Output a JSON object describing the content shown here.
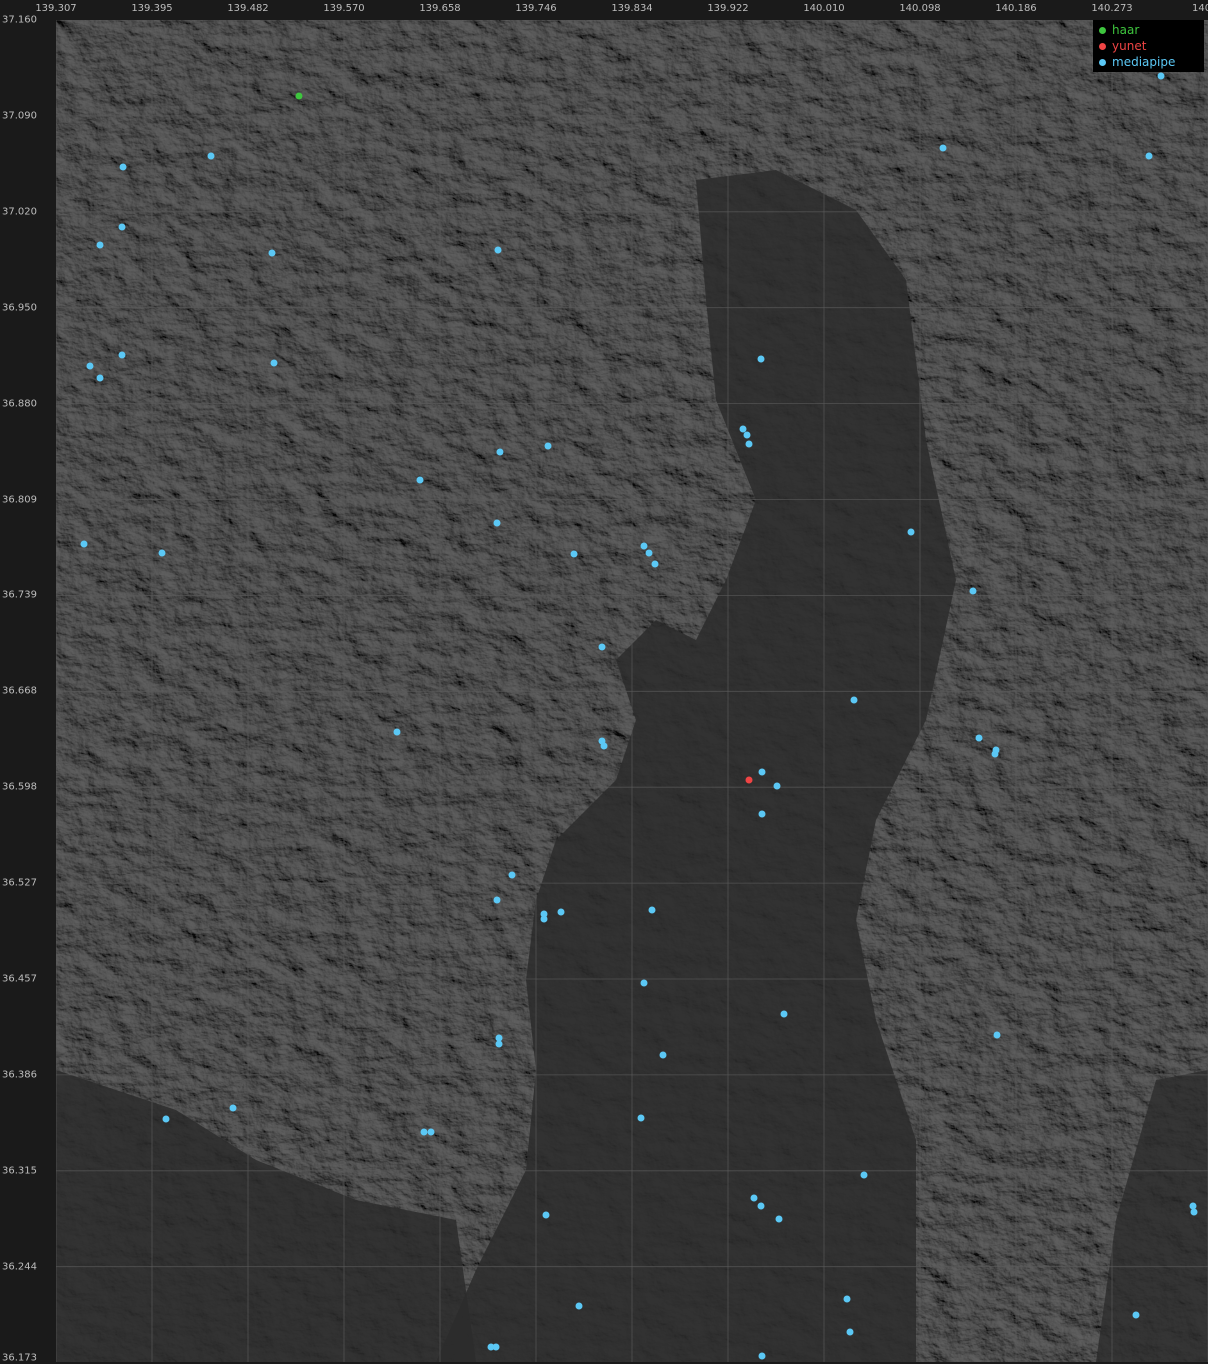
{
  "map": {
    "lon_ticks": [
      "139.307",
      "139.395",
      "139.482",
      "139.570",
      "139.658",
      "139.746",
      "139.834",
      "139.922",
      "140.010",
      "140.098",
      "140.186",
      "140.273",
      "140"
    ],
    "lat_ticks": [
      "37.160",
      "37.090",
      "37.020",
      "36.950",
      "36.880",
      "36.809",
      "36.739",
      "36.668",
      "36.598",
      "36.527",
      "36.457",
      "36.386",
      "36.315",
      "36.244",
      "36.173"
    ],
    "legend": [
      {
        "label": "haar",
        "color": "#3ec53e"
      },
      {
        "label": "yunet",
        "color": "#ef4444"
      },
      {
        "label": "mediapipe",
        "color": "#5bc8f5"
      }
    ],
    "colors": {
      "background": "#1a1a1a",
      "terrain": "#2b2b2b",
      "grid": "#5a5a5a"
    },
    "markers": {
      "haar": [
        [
          139.529,
          37.104
        ]
      ],
      "yunet": [
        [
          139.941,
          36.602
        ]
      ],
      "mediapipe": [
        [
          140.318,
          37.119
        ],
        [
          139.449,
          37.06
        ],
        [
          140.118,
          37.066
        ],
        [
          140.307,
          37.06
        ],
        [
          139.368,
          37.052
        ],
        [
          139.367,
          37.008
        ],
        [
          139.347,
          36.995
        ],
        [
          139.505,
          36.989
        ],
        [
          139.711,
          36.991
        ],
        [
          139.952,
          36.911
        ],
        [
          139.367,
          36.914
        ],
        [
          139.338,
          36.906
        ],
        [
          139.347,
          36.897
        ],
        [
          139.506,
          36.908
        ],
        [
          139.935,
          36.86
        ],
        [
          139.939,
          36.855
        ],
        [
          139.941,
          36.849
        ],
        [
          139.757,
          36.847
        ],
        [
          139.713,
          36.843
        ],
        [
          139.64,
          36.822
        ],
        [
          139.71,
          36.791
        ],
        [
          140.089,
          36.784
        ],
        [
          139.333,
          36.775
        ],
        [
          139.404,
          36.769
        ],
        [
          139.781,
          36.768
        ],
        [
          139.845,
          36.774
        ],
        [
          139.849,
          36.769
        ],
        [
          139.855,
          36.761
        ],
        [
          140.146,
          36.741
        ],
        [
          139.806,
          36.7
        ],
        [
          140.037,
          36.661
        ],
        [
          139.619,
          36.637
        ],
        [
          139.806,
          36.631
        ],
        [
          139.808,
          36.627
        ],
        [
          140.151,
          36.633
        ],
        [
          140.167,
          36.624
        ],
        [
          140.166,
          36.621
        ],
        [
          139.953,
          36.608
        ],
        [
          139.966,
          36.598
        ],
        [
          139.953,
          36.577
        ],
        [
          139.724,
          36.532
        ],
        [
          139.71,
          36.514
        ],
        [
          139.753,
          36.504
        ],
        [
          139.753,
          36.5
        ],
        [
          139.769,
          36.505
        ],
        [
          139.852,
          36.507
        ],
        [
          139.845,
          36.453
        ],
        [
          139.973,
          36.43
        ],
        [
          140.168,
          36.415
        ],
        [
          139.712,
          36.413
        ],
        [
          139.712,
          36.408
        ],
        [
          139.862,
          36.4
        ],
        [
          139.469,
          36.361
        ],
        [
          139.408,
          36.353
        ],
        [
          139.644,
          36.344
        ],
        [
          139.65,
          36.344
        ],
        [
          139.842,
          36.354
        ],
        [
          140.046,
          36.312
        ],
        [
          139.945,
          36.295
        ],
        [
          139.952,
          36.289
        ],
        [
          140.347,
          36.289
        ],
        [
          140.348,
          36.285
        ],
        [
          139.968,
          36.28
        ],
        [
          139.755,
          36.283
        ],
        [
          140.03,
          36.221
        ],
        [
          139.785,
          36.216
        ],
        [
          140.295,
          36.209
        ],
        [
          140.033,
          36.197
        ],
        [
          139.705,
          36.186
        ],
        [
          139.709,
          36.186
        ],
        [
          139.953,
          36.179
        ]
      ]
    }
  }
}
